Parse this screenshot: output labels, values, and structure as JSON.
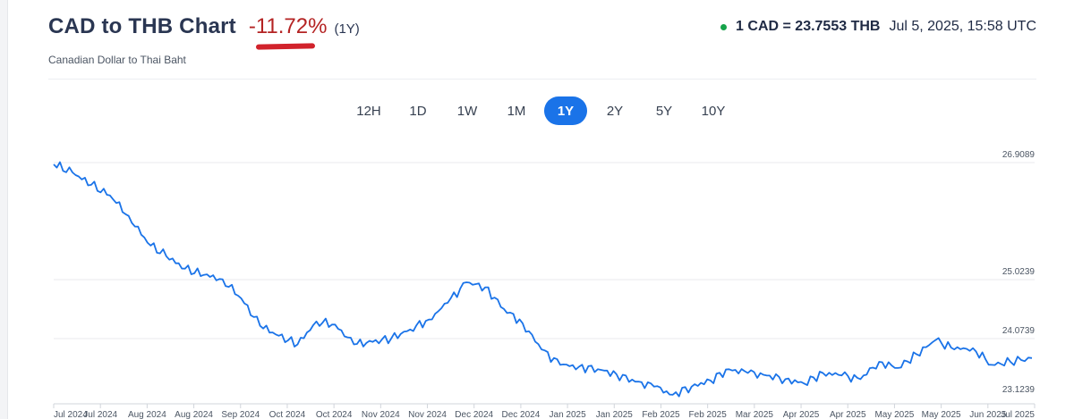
{
  "header": {
    "title": "CAD to THB Chart",
    "change": "-11.72%",
    "period": "(1Y)",
    "subtitle": "Canadian Dollar to Thai Baht",
    "rate": "1 CAD = 23.7553 THB",
    "timestamp": "Jul 5, 2025, 15:58 UTC"
  },
  "ranges": [
    {
      "label": "12H",
      "active": false
    },
    {
      "label": "1D",
      "active": false
    },
    {
      "label": "1W",
      "active": false
    },
    {
      "label": "1M",
      "active": false
    },
    {
      "label": "1Y",
      "active": true
    },
    {
      "label": "2Y",
      "active": false
    },
    {
      "label": "5Y",
      "active": false
    },
    {
      "label": "10Y",
      "active": false
    }
  ],
  "colors": {
    "line": "#1a73e8",
    "change": "#b42323",
    "status_dot": "#16a34a",
    "active_range": "#1a73e8"
  },
  "chart_data": {
    "type": "line",
    "ylim": [
      23.1239,
      26.9089
    ],
    "y_ticks": [
      "26.9089",
      "25.0239",
      "24.0739",
      "23.1239"
    ],
    "x_ticks": [
      "Jul 2024",
      "Jul 2024",
      "Aug 2024",
      "Aug 2024",
      "Sep 2024",
      "Oct 2024",
      "Oct 2024",
      "Nov 2024",
      "Nov 2024",
      "Dec 2024",
      "Dec 2024",
      "Jan 2025",
      "Jan 2025",
      "Feb 2025",
      "Feb 2025",
      "Mar 2025",
      "Apr 2025",
      "Apr 2025",
      "May 2025",
      "May 2025",
      "Jun 2025",
      "Jul 2025"
    ],
    "series": [
      {
        "x": [
          "2024-07-05",
          "2024-07-12",
          "2024-07-19",
          "2024-07-26",
          "2024-08-02",
          "2024-08-09",
          "2024-08-16",
          "2024-08-23",
          "2024-08-30",
          "2024-09-06",
          "2024-09-13",
          "2024-09-20",
          "2024-09-27",
          "2024-10-04",
          "2024-10-11",
          "2024-10-18",
          "2024-10-25",
          "2024-11-01",
          "2024-11-08",
          "2024-11-15",
          "2024-11-22",
          "2024-11-29",
          "2024-12-06",
          "2024-12-13",
          "2024-12-20",
          "2024-12-27",
          "2025-01-03",
          "2025-01-10",
          "2025-01-17",
          "2025-01-24",
          "2025-01-31",
          "2025-02-07",
          "2025-02-14",
          "2025-02-21",
          "2025-02-28",
          "2025-03-07",
          "2025-03-14",
          "2025-03-21",
          "2025-03-28",
          "2025-04-04",
          "2025-04-11",
          "2025-04-18",
          "2025-04-25",
          "2025-05-02",
          "2025-05-09",
          "2025-05-16",
          "2025-05-23",
          "2025-05-30",
          "2025-06-06",
          "2025-06-13",
          "2025-06-20",
          "2025-06-27",
          "2025-07-05"
        ],
        "values": [
          26.88,
          26.75,
          26.55,
          26.38,
          26.05,
          25.62,
          25.4,
          25.2,
          25.1,
          25.03,
          24.72,
          24.28,
          24.12,
          23.98,
          24.35,
          24.3,
          23.98,
          24.02,
          24.08,
          24.22,
          24.38,
          24.65,
          24.98,
          24.9,
          24.55,
          24.32,
          23.9,
          23.65,
          23.62,
          23.58,
          23.5,
          23.38,
          23.3,
          23.17,
          23.3,
          23.4,
          23.58,
          23.52,
          23.48,
          23.42,
          23.35,
          23.52,
          23.48,
          23.42,
          23.7,
          23.6,
          23.82,
          24.05,
          23.9,
          23.92,
          23.65,
          23.7,
          23.76
        ]
      }
    ]
  }
}
